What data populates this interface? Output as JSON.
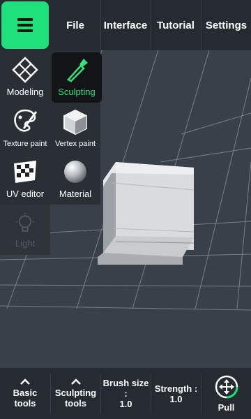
{
  "topbar": {
    "menu_icon": "hamburger-icon",
    "tabs": [
      "File",
      "Interface",
      "Tutorial",
      "Settings"
    ]
  },
  "modes": {
    "modeling": "Modeling",
    "sculpting": "Sculpting",
    "texture_paint": "Texture paint",
    "vertex_paint": "Vertex paint",
    "uv_editor": "UV editor",
    "material": "Material",
    "light": "Light",
    "selected": "Sculpting"
  },
  "bottombar": {
    "basic_tools": "Basic tools",
    "sculpting_tools": "Sculpting tools",
    "brush_size_label": "Brush size :",
    "brush_size_value": "1.0",
    "strength_label": "Strength :",
    "strength_value": "1.0",
    "pull_label": "Pull",
    "pull_icon": "move-arrows-icon"
  },
  "colors": {
    "accent": "#1fe07a",
    "toolbar_bg": "#262a31",
    "viewport_bg": "#394049"
  }
}
